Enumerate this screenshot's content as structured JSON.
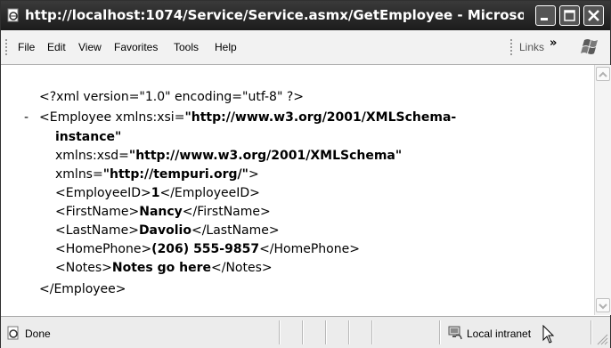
{
  "window": {
    "title": "http://localhost:1074/Service/Service.asmx/GetEmployee - Microsof..."
  },
  "menubar": {
    "items": [
      "File",
      "Edit",
      "View",
      "Favorites",
      "Tools",
      "Help"
    ],
    "links_label": "Links",
    "links_chevron": "»"
  },
  "xml": {
    "declaration": "<?xml version=\"1.0\" encoding=\"utf-8\" ?>",
    "collapse_toggle": "-",
    "employee_open": "<Employee ",
    "xsi_attr": "xmlns:xsi=",
    "xsi_value_1": "\"http://www.w3.org/2001/XMLSchema-",
    "xsi_value_2": "instance\"",
    "xsd_attr": "xmlns:xsd=",
    "xsd_value": "\"http://www.w3.org/2001/XMLSchema\"",
    "ns_attr": "xmlns=",
    "ns_value": "\"http://tempuri.org/\"",
    "ns_close": ">",
    "fields": [
      {
        "open": "<EmployeeID>",
        "value": "1",
        "close": "</EmployeeID>"
      },
      {
        "open": "<FirstName>",
        "value": "Nancy",
        "close": "</FirstName>"
      },
      {
        "open": "<LastName>",
        "value": "Davolio",
        "close": "</LastName>"
      },
      {
        "open": "<HomePhone>",
        "value": "(206) 555-9857",
        "close": "</HomePhone>"
      },
      {
        "open": "<Notes>",
        "value": "Notes go here",
        "close": "</Notes>"
      }
    ],
    "employee_close": "</Employee>"
  },
  "statusbar": {
    "status": "Done",
    "zone": "Local intranet"
  },
  "icons": {
    "title": "ie-page-icon",
    "minimize": "minimize-icon",
    "maximize": "maximize-icon",
    "close": "close-icon",
    "logo": "windows-flag-icon",
    "status": "ie-page-icon",
    "zone": "local-intranet-icon"
  }
}
